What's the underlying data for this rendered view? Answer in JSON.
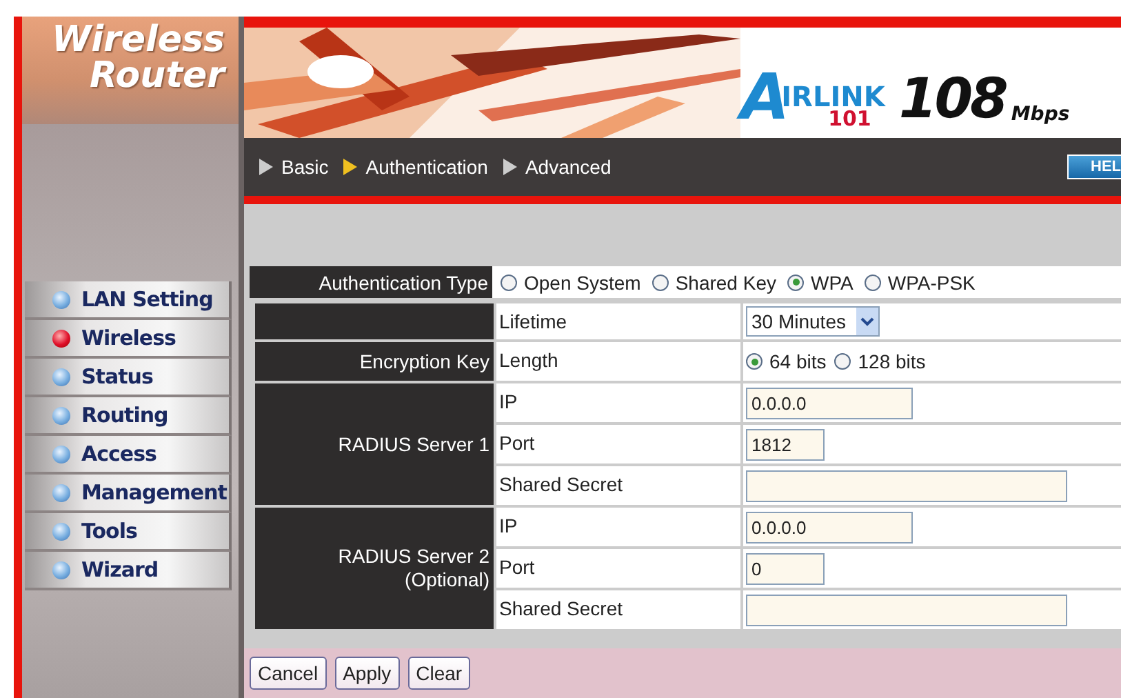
{
  "sidebar": {
    "title_lines": [
      "Wireless",
      "Router"
    ],
    "items": [
      {
        "label": "LAN Setting",
        "selected": false
      },
      {
        "label": "Wireless",
        "selected": true
      },
      {
        "label": "Status",
        "selected": false
      },
      {
        "label": "Routing",
        "selected": false
      },
      {
        "label": "Access",
        "selected": false
      },
      {
        "label": "Management",
        "selected": false
      },
      {
        "label": "Tools",
        "selected": false
      },
      {
        "label": "Wizard",
        "selected": false
      }
    ]
  },
  "header": {
    "logo_initial": "A",
    "logo_rest": "IRLINK",
    "logo_sub": "101",
    "speed": "108",
    "speed_unit": "Mbps"
  },
  "nav": {
    "tabs": [
      {
        "label": "Basic",
        "selected": false
      },
      {
        "label": "Authentication",
        "selected": true
      },
      {
        "label": "Advanced",
        "selected": false
      }
    ],
    "help_button": "HEL"
  },
  "authentication_type": {
    "label": "Authentication Type",
    "options": [
      {
        "label": "Open System",
        "selected": false
      },
      {
        "label": "Shared Key",
        "selected": false
      },
      {
        "label": "WPA",
        "selected": true
      },
      {
        "label": "WPA-PSK",
        "selected": false
      }
    ]
  },
  "groups": [
    {
      "rows": [
        {
          "label": "Lifetime",
          "kind": "select",
          "value": "30 Minutes"
        }
      ]
    },
    {
      "heading_lines": [
        "Encryption Key"
      ],
      "rows": [
        {
          "label": "Length",
          "kind": "radio",
          "options": [
            {
              "label": "64 bits",
              "selected": true
            },
            {
              "label": "128 bits",
              "selected": false
            }
          ]
        }
      ]
    },
    {
      "heading_lines": [
        "RADIUS Server 1"
      ],
      "rows": [
        {
          "label": "IP",
          "kind": "ip_input",
          "value": "0.0.0.0"
        },
        {
          "label": "Port",
          "kind": "port_input",
          "value": "1812"
        },
        {
          "label": "Shared Secret",
          "kind": "text_input"
        }
      ]
    },
    {
      "heading_lines": [
        "RADIUS Server 2",
        "(Optional)"
      ],
      "rows": [
        {
          "label": "IP",
          "kind": "ip_input",
          "value": "0.0.0.0"
        },
        {
          "label": "Port",
          "kind": "port_input",
          "value": "0"
        },
        {
          "label": "Shared Secret",
          "kind": "text_input"
        }
      ]
    }
  ],
  "buttons": [
    "Cancel",
    "Apply",
    "Clear"
  ]
}
